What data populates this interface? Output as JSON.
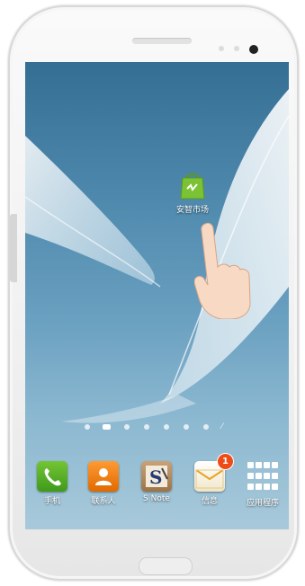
{
  "home_screen": {
    "shortcut": {
      "label": "安智市场",
      "icon": "market-bag-icon"
    },
    "pages": {
      "count": 8,
      "active_index": 1
    },
    "dock": [
      {
        "label": "手机",
        "icon": "phone-icon"
      },
      {
        "label": "联系人",
        "icon": "contacts-icon"
      },
      {
        "label": "S Note",
        "icon": "snote-icon"
      },
      {
        "label": "信息",
        "icon": "message-icon",
        "badge": "1"
      },
      {
        "label": "应用程序",
        "icon": "apps-grid-icon"
      }
    ]
  },
  "colors": {
    "wallpaper_top": "#356e93",
    "wallpaper_bottom": "#a8c9da",
    "market_green": "#7bc334",
    "badge": "#ee4b16"
  }
}
